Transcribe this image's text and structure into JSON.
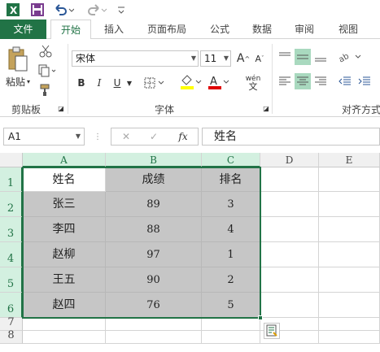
{
  "tabs": {
    "file": "文件",
    "home": "开始",
    "insert": "插入",
    "layout": "页面布局",
    "formulas": "公式",
    "data": "数据",
    "review": "审阅",
    "view": "视图"
  },
  "ribbon": {
    "paste_label": "粘贴",
    "clipboard_label": "剪贴板",
    "font_group_label": "字体",
    "align_group_label": "对齐方式",
    "font_name": "宋体",
    "font_size": "11",
    "bold": "B",
    "italic": "I",
    "underline": "U",
    "phonetic": "wén"
  },
  "formula_bar": {
    "name_box": "A1",
    "cancel": "✕",
    "enter": "✓",
    "fx": "fx",
    "content": "姓名"
  },
  "columns": [
    "A",
    "B",
    "C",
    "D",
    "E"
  ],
  "rows": [
    "1",
    "2",
    "3",
    "4",
    "5",
    "6",
    "7",
    "8"
  ],
  "table": {
    "header": [
      "姓名",
      "成绩",
      "排名"
    ],
    "rows": [
      [
        "张三",
        "89",
        "3"
      ],
      [
        "李四",
        "88",
        "4"
      ],
      [
        "赵柳",
        "97",
        "1"
      ],
      [
        "王五",
        "90",
        "2"
      ],
      [
        "赵四",
        "76",
        "5"
      ]
    ]
  },
  "colors": {
    "accent": "#217346",
    "selection_fill": "#c6c6c6",
    "header_selected": "#d3f0e0"
  }
}
